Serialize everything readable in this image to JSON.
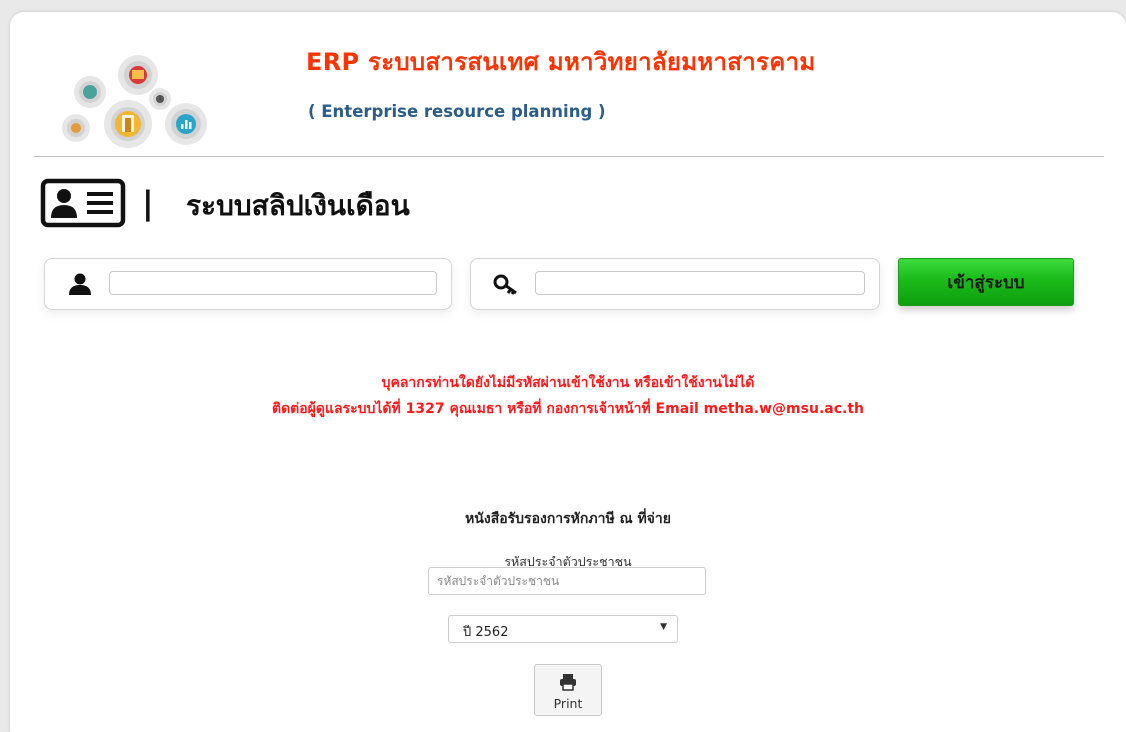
{
  "header": {
    "title": "ERP ระบบสารสนเทศ มหาวิทยาลัยมหาสารคาม",
    "subtitle": "( Enterprise resource planning )"
  },
  "system": {
    "title": "ระบบสลิปเงินเดือน",
    "separator": "|"
  },
  "login": {
    "username_value": "",
    "password_value": "",
    "submit_label": "เข้าสู่ระบบ",
    "button_color": "#1cbe1c"
  },
  "notice": {
    "line1": "บุคลากรท่านใดยังไม่มีรหัสผ่านเข้าใช้งาน หรือเข้าใช้งานไม่ได้",
    "line2": "ติดต่อผู้ดูแลระบบได้ที่ 1327 คุณเมธา หรือที่ กองการเจ้าหน้าที่ Email metha.w@msu.ac.th",
    "color": "#ff1a1a"
  },
  "tax_certificate": {
    "title": "หนังสือรับรองการหักภาษี ณ ที่จ่าย",
    "id_label": "รหัสประจำตัวประชาชน",
    "id_placeholder": "รหัสประจำตัวประชาชน",
    "year_selected": "ปี 2562",
    "print_label": "Print"
  },
  "icons": {
    "logo": "gears-logo-icon",
    "system": "id-card-icon",
    "username": "user-icon",
    "password": "key-icon",
    "print": "printer-icon",
    "dropdown": "caret-down-icon"
  },
  "colors": {
    "title": "#ff3300",
    "subtitle": "#2a5d8a"
  }
}
